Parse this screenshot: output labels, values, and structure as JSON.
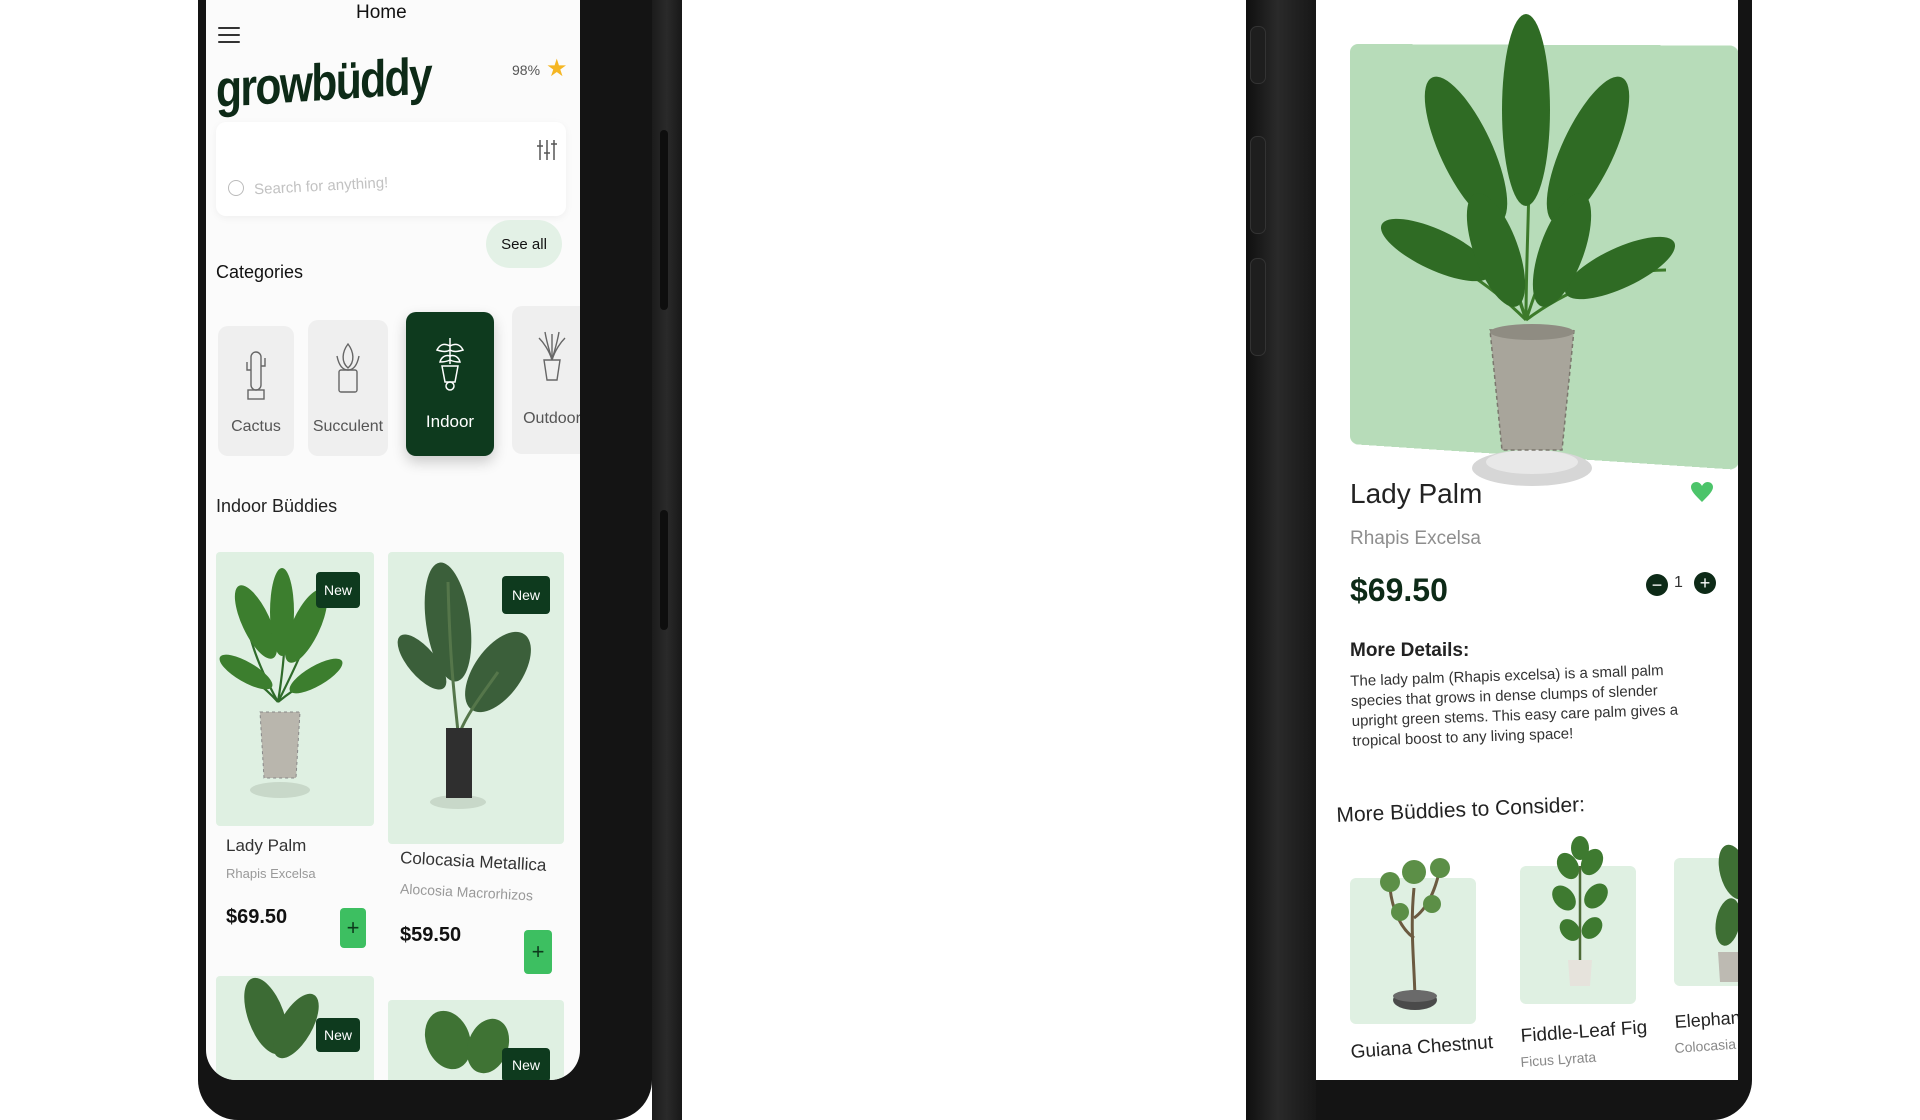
{
  "left_screen": {
    "header": {
      "title": "Home"
    },
    "logo": "growbüddy",
    "rating": {
      "value": "98%",
      "icon": "star-icon"
    },
    "search": {
      "placeholder": "Search for anything!"
    },
    "categories": {
      "title": "Categories",
      "see_all_label": "See all",
      "items": [
        {
          "label": "Cactus",
          "icon": "cactus-icon",
          "active": false
        },
        {
          "label": "Succulent",
          "icon": "succulent-icon",
          "active": false
        },
        {
          "label": "Indoor",
          "icon": "indoor-plant-icon",
          "active": true
        },
        {
          "label": "Outdoor",
          "icon": "outdoor-plant-icon",
          "active": false
        }
      ]
    },
    "section_title": "Indoor Büddies",
    "plants": [
      {
        "badge": "New",
        "name": "Lady Palm",
        "scientific": "Rhapis Excelsa",
        "price": "$69.50"
      },
      {
        "badge": "New",
        "name": "Colocasia Metallica",
        "scientific": "Alocosia Macrorhizos",
        "price": "$59.50"
      },
      {
        "badge": "New"
      },
      {
        "badge": "New"
      }
    ],
    "colors": {
      "primary": "#0e3a1e",
      "accent": "#3dbf61",
      "card_bg": "#dff0e2"
    }
  },
  "right_screen": {
    "product": {
      "name": "Lady Palm",
      "scientific": "Rhapis Excelsa",
      "price": "$69.50",
      "quantity": "1",
      "favorite_icon": "heart-icon"
    },
    "details": {
      "title": "More Details:",
      "text": "The lady palm (Rhapis excelsa) is a small palm species that grows in dense clumps of slender upright green stems. This easy care palm gives a tropical boost to any living space!"
    },
    "more_buddies": {
      "title": "More Büddies to Consider:",
      "items": [
        {
          "name": "Guiana Chestnut",
          "scientific": ""
        },
        {
          "name": "Fiddle-Leaf Fig",
          "scientific": "Ficus Lyrata"
        },
        {
          "name": "Elephant",
          "scientific": "Colocasia E"
        }
      ]
    },
    "colors": {
      "hero_bg": "#b7dcb9",
      "heart": "#4cc46a"
    }
  }
}
